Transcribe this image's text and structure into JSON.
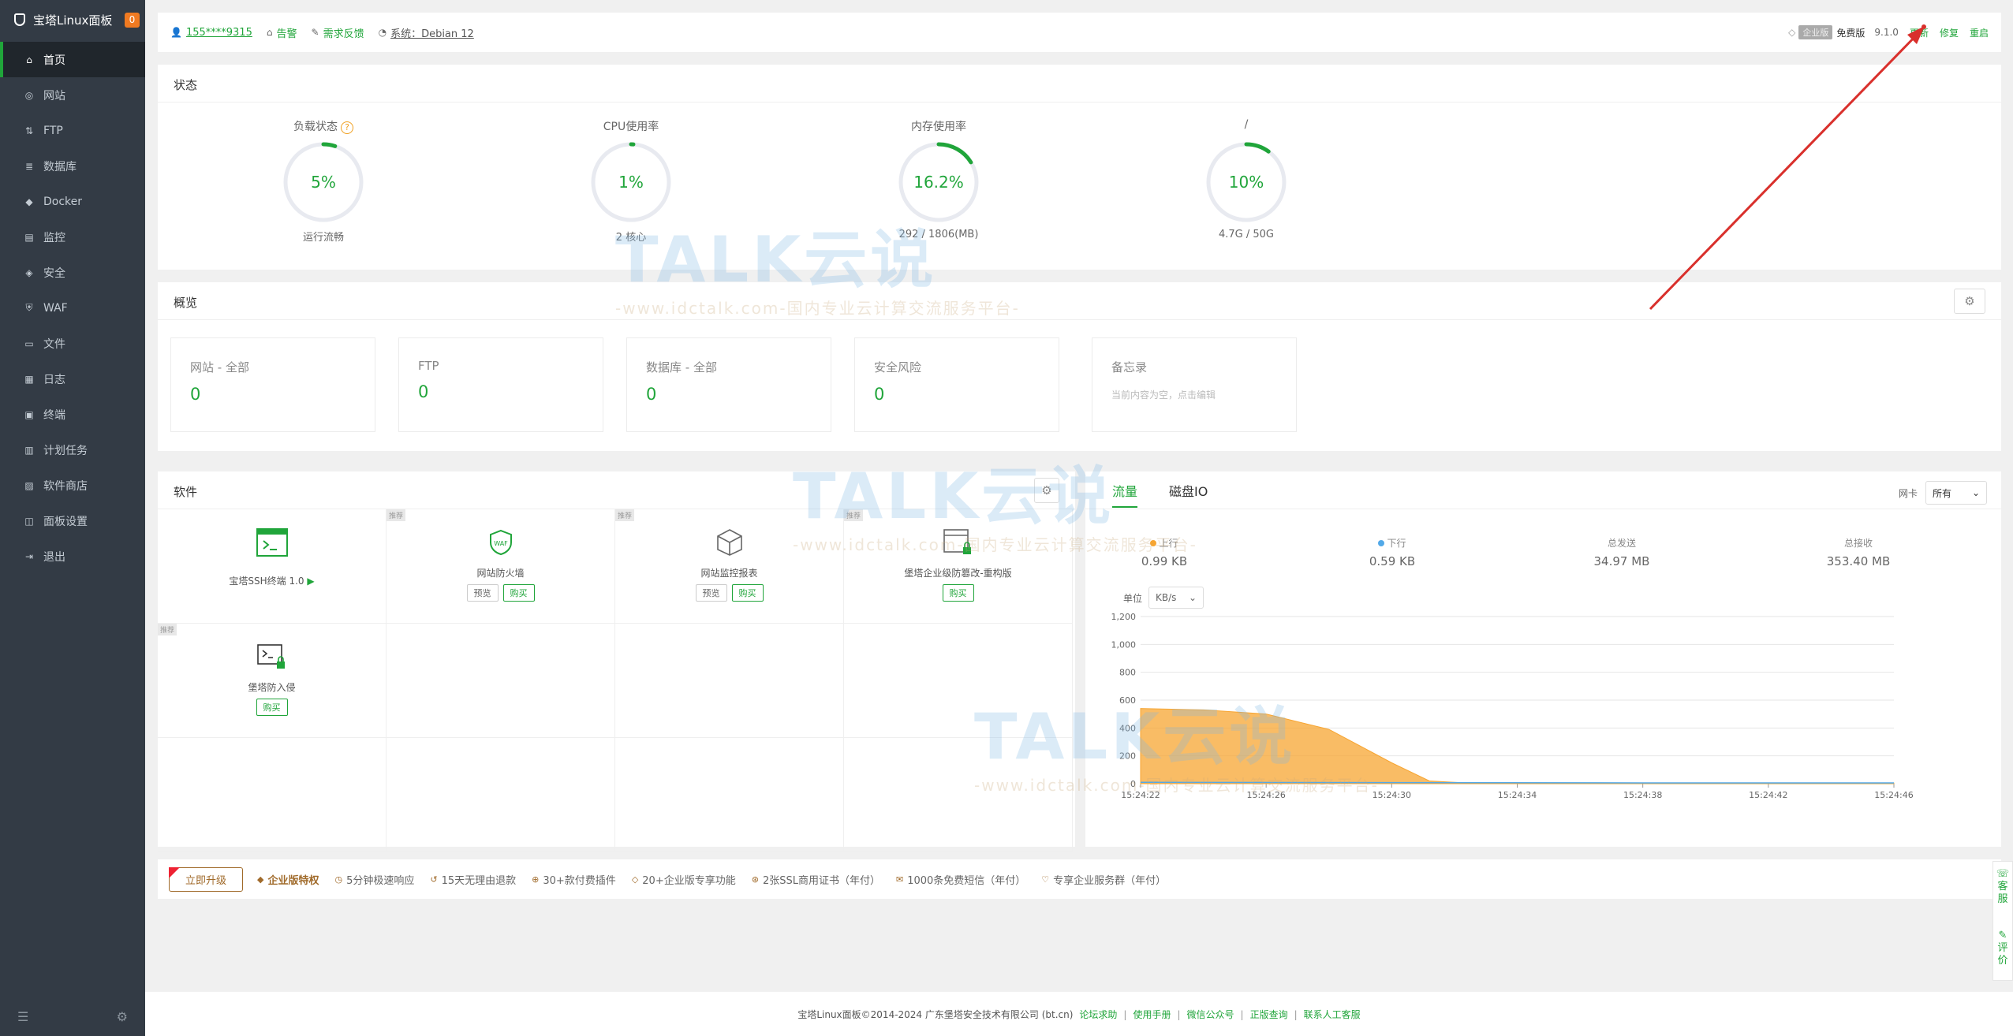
{
  "sidebar": {
    "title": "宝塔Linux面板",
    "badge": "0",
    "items": [
      {
        "label": "首页",
        "icon": "home-icon"
      },
      {
        "label": "网站",
        "icon": "globe-icon"
      },
      {
        "label": "FTP",
        "icon": "ftp-icon"
      },
      {
        "label": "数据库",
        "icon": "database-icon"
      },
      {
        "label": "Docker",
        "icon": "docker-icon"
      },
      {
        "label": "监控",
        "icon": "monitor-icon"
      },
      {
        "label": "安全",
        "icon": "shield-icon"
      },
      {
        "label": "WAF",
        "icon": "waf-icon"
      },
      {
        "label": "文件",
        "icon": "folder-icon"
      },
      {
        "label": "日志",
        "icon": "log-icon"
      },
      {
        "label": "终端",
        "icon": "terminal-icon"
      },
      {
        "label": "计划任务",
        "icon": "calendar-icon"
      },
      {
        "label": "软件商店",
        "icon": "store-icon"
      },
      {
        "label": "面板设置",
        "icon": "settings-icon"
      },
      {
        "label": "退出",
        "icon": "logout-icon"
      }
    ]
  },
  "topbar": {
    "user": "155****9315",
    "alarm": "告警",
    "feedback": "需求反馈",
    "system": "系统：Debian 12",
    "ent_tag": "企业版",
    "edition": "免费版",
    "version": "9.1.0",
    "update": "更新",
    "repair": "修复",
    "restart": "重启"
  },
  "status": {
    "title": "状态",
    "gauges": [
      {
        "title": "负载状态",
        "value": "5%",
        "percent": 5,
        "sub": "运行流畅"
      },
      {
        "title": "CPU使用率",
        "value": "1%",
        "percent": 1,
        "sub": "2 核心"
      },
      {
        "title": "内存使用率",
        "value": "16.2%",
        "percent": 16.2,
        "sub": "292 / 1806(MB)"
      },
      {
        "title": "/",
        "value": "10%",
        "percent": 10,
        "sub": "4.7G / 50G"
      }
    ]
  },
  "overview": {
    "title": "概览",
    "boxes": [
      {
        "label": "网站 - 全部",
        "value": "0"
      },
      {
        "label": "FTP",
        "value": "0"
      },
      {
        "label": "数据库 - 全部",
        "value": "0"
      },
      {
        "label": "安全风险",
        "value": "0"
      }
    ],
    "memo_label": "备忘录",
    "memo_note": "当前内容为空，点击编辑"
  },
  "software": {
    "title": "软件",
    "tag": "推荐",
    "preview": "预览",
    "buy": "购买",
    "items": [
      {
        "name": "宝塔SSH终端 1.0",
        "icon": "ssh-terminal-icon"
      },
      {
        "name": "网站防火墙",
        "icon": "waf-shield-icon"
      },
      {
        "name": "网站监控报表",
        "icon": "cube-icon"
      },
      {
        "name": "堡塔企业级防篡改-重构版",
        "icon": "tamper-proof-icon"
      },
      {
        "name": "堡塔防入侵",
        "icon": "intrusion-icon"
      }
    ]
  },
  "traffic": {
    "tab_traffic": "流量",
    "tab_disk": "磁盘IO",
    "nic_label": "网卡",
    "nic_value": "所有",
    "up_label": "上行",
    "up_value": "0.99 KB",
    "down_label": "下行",
    "down_value": "0.59 KB",
    "sent_label": "总发送",
    "sent_value": "34.97 MB",
    "recv_label": "总接收",
    "recv_value": "353.40 MB",
    "unit_label": "单位",
    "unit_value": "KB/s",
    "colors": {
      "up": "#f7a531",
      "down": "#52a9e8"
    }
  },
  "chart_data": {
    "type": "area",
    "x": [
      "15:24:22",
      "15:24:26",
      "15:24:30",
      "15:24:34",
      "15:24:38",
      "15:24:42",
      "15:24:46"
    ],
    "ylim": [
      0,
      1200
    ],
    "yticks": [
      "0",
      "200",
      "400",
      "600",
      "800",
      "1,000",
      "1,200"
    ],
    "series": [
      {
        "name": "上行",
        "points": [
          [
            0,
            540
          ],
          [
            0.5,
            530
          ],
          [
            1,
            500
          ],
          [
            1.5,
            390
          ],
          [
            2,
            150
          ],
          [
            2.3,
            20
          ],
          [
            2.6,
            5
          ],
          [
            6,
            4
          ]
        ]
      },
      {
        "name": "下行",
        "points": [
          [
            0,
            10
          ],
          [
            2,
            8
          ],
          [
            4,
            6
          ],
          [
            6,
            6
          ]
        ]
      }
    ]
  },
  "probar": {
    "upgrade": "立即升级",
    "title": "企业版特权",
    "items": [
      "5分钟极速响应",
      "15天无理由退款",
      "30+款付费插件",
      "20+企业版专享功能",
      "2张SSL商用证书（年付）",
      "1000条免费短信（年付）",
      "专享企业服务群（年付）"
    ]
  },
  "footer": {
    "copyright": "宝塔Linux面板©2014-2024 广东堡塔安全技术有限公司 (bt.cn)",
    "links": [
      "论坛求助",
      "使用手册",
      "微信公众号",
      "正版查询",
      "联系人工客服"
    ]
  },
  "float": {
    "service": "客服",
    "review": "评价"
  },
  "watermark": {
    "text": "TALK云说",
    "sub": "-www.idctalk.com-国内专业云计算交流服务平台-"
  }
}
